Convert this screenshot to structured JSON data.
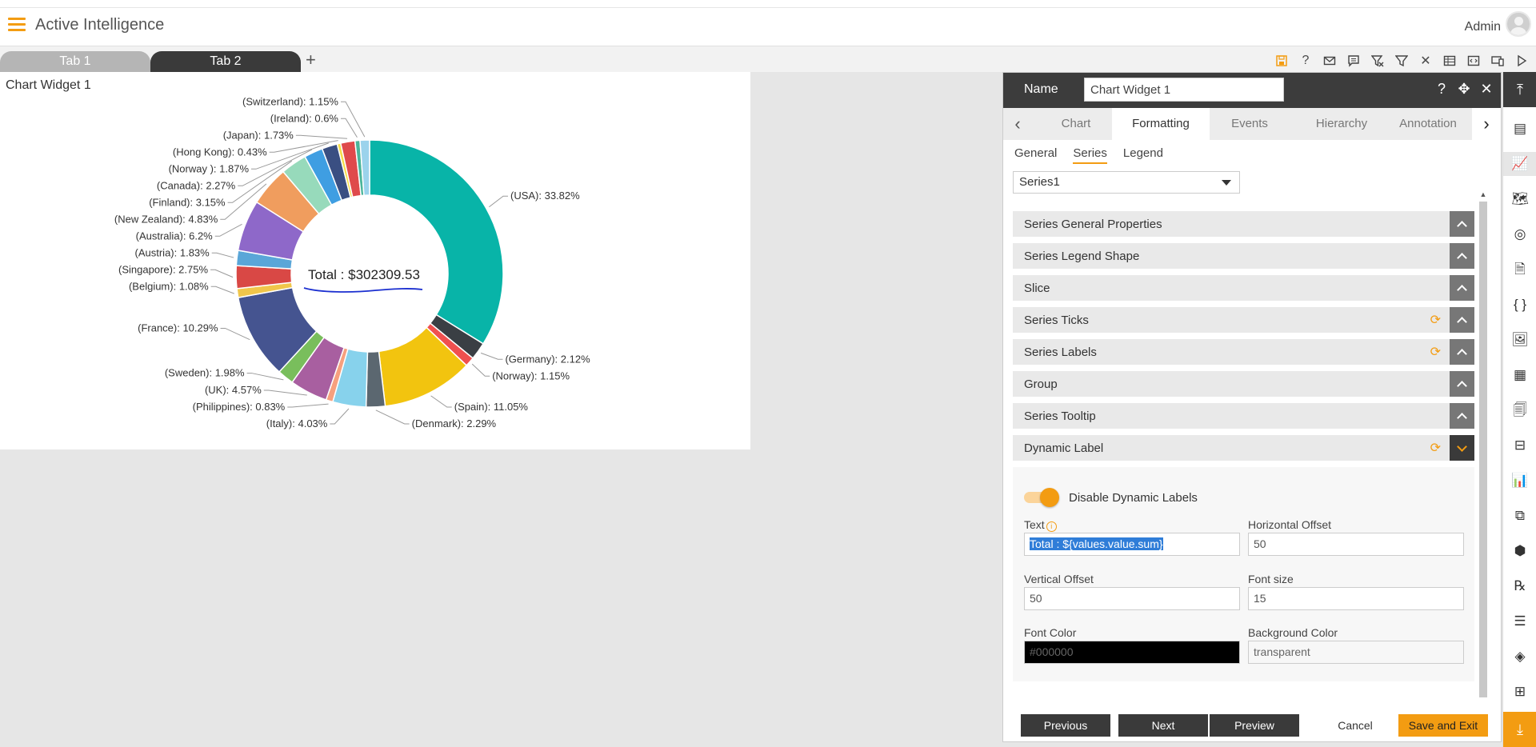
{
  "app": {
    "title": "Active Intelligence",
    "user": "Admin"
  },
  "tabs": [
    {
      "label": "Tab 1"
    },
    {
      "label": "Tab 2"
    }
  ],
  "tab_add": "+",
  "toolbar": [
    "save-icon",
    "help-icon",
    "mail-icon",
    "comment-icon",
    "clear-filter-icon",
    "filter-icon",
    "tools-icon",
    "table-icon",
    "embed-icon",
    "devices-icon",
    "play-icon"
  ],
  "widget": {
    "title": "Chart Widget 1",
    "dynamic_label": "Total : $302309.53"
  },
  "chart_data": {
    "type": "pie",
    "title": "",
    "center_label": "Total : $302309.53",
    "labels": [
      "(USA): 33.82%",
      "(Germany): 2.12%",
      "(Norway): 1.15%",
      "(Spain): 11.05%",
      "(Denmark): 2.29%",
      "(Italy): 4.03%",
      "(Philippines): 0.83%",
      "(UK): 4.57%",
      "(Sweden): 1.98%",
      "(France): 10.29%",
      "(Belgium): 1.08%",
      "(Singapore): 2.75%",
      "(Austria): 1.83%",
      "(Australia): 6.2%",
      "(New Zealand): 4.83%",
      "(Finland): 3.15%",
      "(Canada): 2.27%",
      "(Norway ): 1.87%",
      "(Hong Kong): 0.43%",
      "(Japan): 1.73%",
      "(Ireland): 0.6%",
      "(Switzerland): 1.15%"
    ],
    "values": [
      33.82,
      2.12,
      1.15,
      11.05,
      2.29,
      4.03,
      0.83,
      4.57,
      1.98,
      10.29,
      1.08,
      2.75,
      1.83,
      6.2,
      4.83,
      3.15,
      2.27,
      1.87,
      0.43,
      1.73,
      0.6,
      1.15
    ],
    "colors": [
      "#08b4a8",
      "#3a3f44",
      "#f0504f",
      "#f2c40f",
      "#5b6770",
      "#87d2ec",
      "#f6a07e",
      "#a85fa0",
      "#79be5c",
      "#455490",
      "#f0c64b",
      "#d94845",
      "#5aa6d8",
      "#8e68c9",
      "#f09d5e",
      "#97dabb",
      "#3f9ee2",
      "#3a4f82",
      "#f5dd48",
      "#df4a4b",
      "#4ab59a",
      "#9bd3ec"
    ],
    "display_sum_label": "Total : $302309.53"
  },
  "panel": {
    "name_label": "Name",
    "name_value": "Chart Widget 1",
    "head_icons": [
      "help-icon",
      "move-icon",
      "close-icon"
    ],
    "main_tabs": [
      {
        "label": "Chart"
      },
      {
        "label": "Formatting"
      },
      {
        "label": "Events"
      },
      {
        "label": "Hierarchy"
      },
      {
        "label": "Annotation"
      }
    ],
    "sub_tabs": [
      {
        "label": "General"
      },
      {
        "label": "Series"
      },
      {
        "label": "Legend"
      }
    ],
    "series_select": "Series1",
    "sections": [
      {
        "label": "Series General Properties",
        "refresh": false
      },
      {
        "label": "Series Legend Shape",
        "refresh": false
      },
      {
        "label": "Slice",
        "refresh": false
      },
      {
        "label": "Series Ticks",
        "refresh": true
      },
      {
        "label": "Series Labels",
        "refresh": true
      },
      {
        "label": "Group",
        "refresh": false
      },
      {
        "label": "Series Tooltip",
        "refresh": false
      },
      {
        "label": "Dynamic Label",
        "refresh": true
      }
    ],
    "dynamic": {
      "toggle_label": "Disable Dynamic Labels",
      "text_label": "Text",
      "text_value": "Total : ${values.value.sum}",
      "h_offset_label": "Horizontal Offset",
      "h_offset_value": "50",
      "v_offset_label": "Vertical Offset",
      "v_offset_value": "50",
      "font_size_label": "Font size",
      "font_size_value": "15",
      "font_color_label": "Font Color",
      "font_color_value": "#000000",
      "bg_color_label": "Background Color",
      "bg_color_value": "transparent"
    },
    "buttons": {
      "previous": "Previous",
      "next": "Next",
      "preview": "Preview",
      "cancel": "Cancel",
      "save_exit": "Save and Exit"
    }
  },
  "colors": {
    "accent": "#f39c12",
    "dark": "#3a3a3a"
  }
}
